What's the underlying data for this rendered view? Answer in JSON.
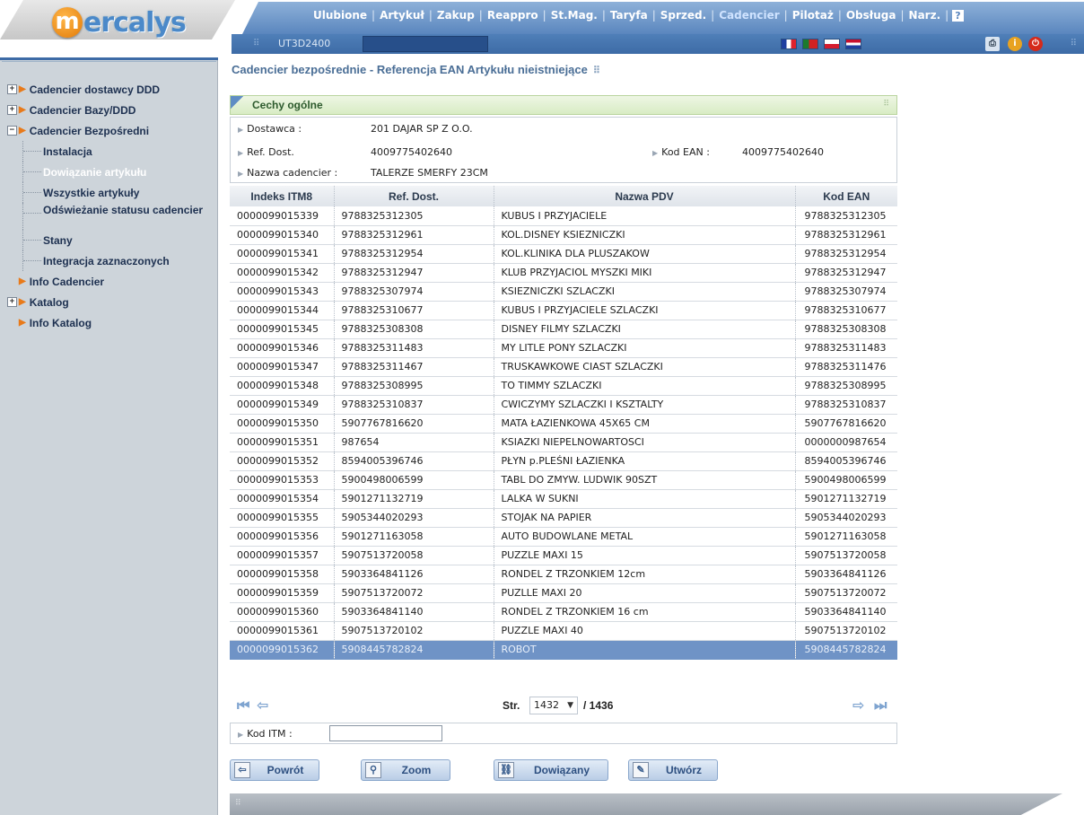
{
  "brand": {
    "logo_letter": "m",
    "logo_text": "ercalys"
  },
  "topnav": {
    "items": [
      "Ulubione",
      "Artykuł",
      "Zakup",
      "Reappro",
      "St.Mag.",
      "Taryfa",
      "Sprzed.",
      "Cadencier",
      "Pilotaż",
      "Obsługa",
      "Narz."
    ],
    "active": "Cadencier",
    "help_label": "?"
  },
  "subbar": {
    "user_code": "UT3D2400",
    "tools": [
      "print-icon",
      "info-icon",
      "power-icon"
    ]
  },
  "sidebar": {
    "items": [
      {
        "label": "Cadencier dostawcy DDD",
        "expander": "+"
      },
      {
        "label": "Cadencier Bazy/DDD",
        "expander": "+"
      },
      {
        "label": "Cadencier Bezpośredni",
        "expander": "−"
      },
      {
        "label": "Instalacja"
      },
      {
        "label": "Dowiązanie artykułu",
        "current": true
      },
      {
        "label": "Wszystkie artykuły"
      },
      {
        "label": "Odświeżanie statusu cadencier"
      },
      {
        "label": "Stany"
      },
      {
        "label": "Integracja zaznaczonych"
      },
      {
        "label": "Info Cadencier"
      },
      {
        "label": "Katalog",
        "expander": "+"
      },
      {
        "label": "Info Katalog"
      }
    ]
  },
  "page": {
    "title": "Cadencier bezpośrednie - Referencja EAN Artykułu nieistniejące",
    "title_grip": "⠿"
  },
  "section": {
    "title": "Cechy ogólne"
  },
  "info": {
    "supplier_label": "Dostawca :",
    "supplier_value": "201 DAJAR SP Z O.O.",
    "ref_label": "Ref. Dost.",
    "ref_value": "4009775402640",
    "ean_label": "Kod EAN :",
    "ean_value": "4009775402640",
    "name_label": "Nazwa cadencier :",
    "name_value": "TALERZE SMERFY 23CM"
  },
  "table": {
    "columns": [
      "Indeks ITM8",
      "Ref. Dost.",
      "Nazwa PDV",
      "Kod EAN"
    ],
    "selected_index": 24,
    "rows": [
      [
        "0000099015339",
        "9788325312305",
        "KUBUS I PRZYJACIELE",
        "9788325312305"
      ],
      [
        "0000099015340",
        "9788325312961",
        "KOL.DISNEY KSIEZNICZKI",
        "9788325312961"
      ],
      [
        "0000099015341",
        "9788325312954",
        "KOL.KLINIKA DLA PLUSZAKOW",
        "9788325312954"
      ],
      [
        "0000099015342",
        "9788325312947",
        "KLUB PRZYJACIOL MYSZKI MIKI",
        "9788325312947"
      ],
      [
        "0000099015343",
        "9788325307974",
        "KSIEZNICZKI SZLACZKI",
        "9788325307974"
      ],
      [
        "0000099015344",
        "9788325310677",
        "KUBUS I PRZYJACIELE SZLACZKI",
        "9788325310677"
      ],
      [
        "0000099015345",
        "9788325308308",
        "DISNEY FILMY SZLACZKI",
        "9788325308308"
      ],
      [
        "0000099015346",
        "9788325311483",
        "MY LITLE PONY SZLACZKI",
        "9788325311483"
      ],
      [
        "0000099015347",
        "9788325311467",
        "TRUSKAWKOWE CIAST SZLACZKI",
        "9788325311476"
      ],
      [
        "0000099015348",
        "9788325308995",
        "TO TIMMY SZLACZKI",
        "9788325308995"
      ],
      [
        "0000099015349",
        "9788325310837",
        "CWICZYMY SZLACZKI I KSZTALTY",
        "9788325310837"
      ],
      [
        "0000099015350",
        "5907767816620",
        "MATA ŁAZIENKOWA 45X65 CM",
        "5907767816620"
      ],
      [
        "0000099015351",
        "987654",
        "KSIAZKI NIEPELNOWARTOSCI",
        "0000000987654"
      ],
      [
        "0000099015352",
        "8594005396746",
        "PŁYN p.PLEŚNI ŁAZIENKA",
        "8594005396746"
      ],
      [
        "0000099015353",
        "5900498006599",
        "TABL DO ZMYW. LUDWIK 90SZT",
        "5900498006599"
      ],
      [
        "0000099015354",
        "5901271132719",
        "LALKA W SUKNI",
        "5901271132719"
      ],
      [
        "0000099015355",
        "5905344020293",
        "STOJAK NA PAPIER",
        "5905344020293"
      ],
      [
        "0000099015356",
        "5901271163058",
        "AUTO BUDOWLANE METAL",
        "5901271163058"
      ],
      [
        "0000099015357",
        "5907513720058",
        "PUZZLE MAXI 15",
        "5907513720058"
      ],
      [
        "0000099015358",
        "5903364841126",
        "RONDEL Z TRZONKIEM 12cm",
        "5903364841126"
      ],
      [
        "0000099015359",
        "5907513720072",
        "PUZLLE MAXI 20",
        "5907513720072"
      ],
      [
        "0000099015360",
        "5903364841140",
        "RONDEL Z TRZONKIEM 16 cm",
        "5903364841140"
      ],
      [
        "0000099015361",
        "5907513720102",
        "PUZZLE MAXI 40",
        "5907513720102"
      ],
      [
        "0000099015362",
        "5908445782824",
        "ROBOT",
        "5908445782824"
      ]
    ]
  },
  "pager": {
    "label": "Str.",
    "current": "1432",
    "total": "/ 1436"
  },
  "itm": {
    "label": "Kod ITM :",
    "value": ""
  },
  "actions": {
    "back": "Powrót",
    "zoom": "Zoom",
    "linked": "Dowiązany",
    "create": "Utwórz"
  },
  "colors": {
    "accent": "#5a86be",
    "selected_row": "#6f93c6",
    "sidebar_bg": "#cdd4da",
    "section_bg": "#d8ecc4"
  }
}
